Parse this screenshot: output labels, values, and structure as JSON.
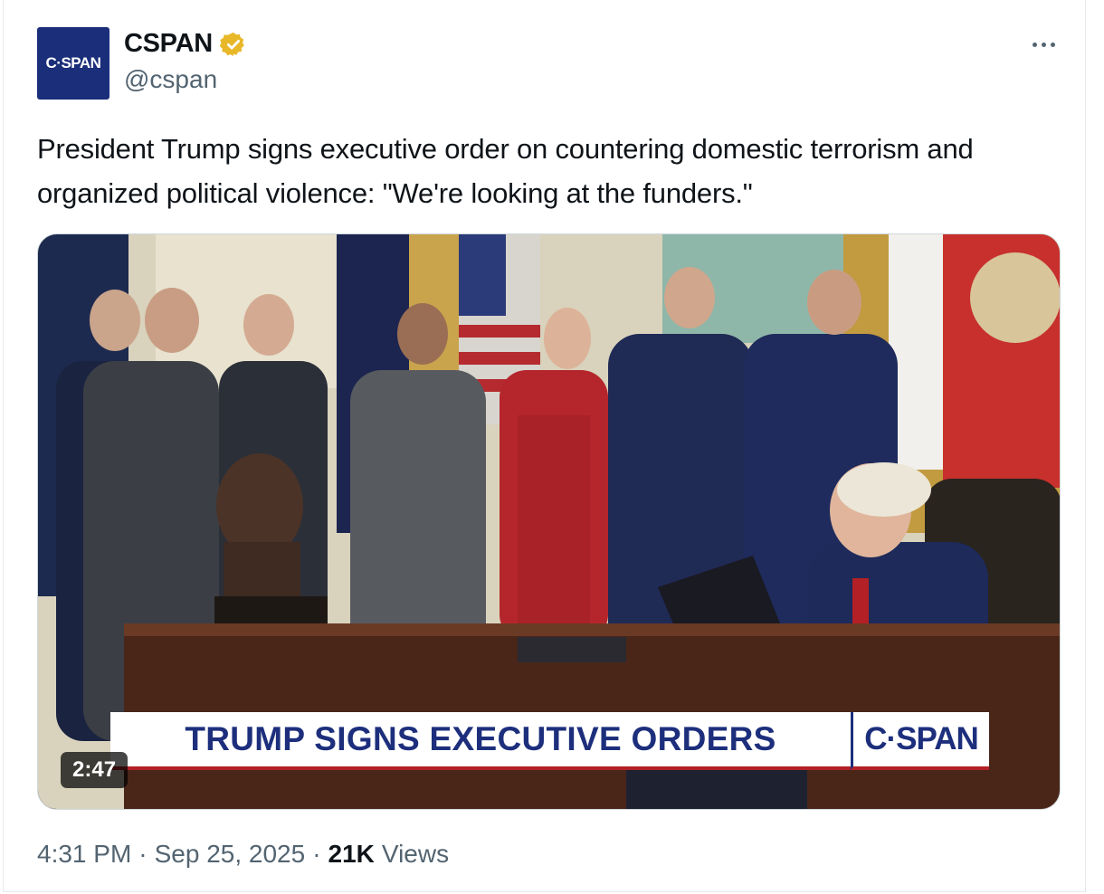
{
  "account": {
    "avatar_text": "C·SPAN",
    "display_name": "CSPAN",
    "handle": "@cspan",
    "verified": true
  },
  "tweet": {
    "text": "President Trump signs executive order on countering domestic terrorism and organized political violence: \"We're looking at the funders.\""
  },
  "media": {
    "lower_third": "TRUMP SIGNS EXECUTIVE ORDERS",
    "network_bug": "C·SPAN",
    "duration": "2:47"
  },
  "meta": {
    "time": "4:31 PM",
    "date": "Sep 25, 2025",
    "views_count": "21K",
    "views_label": "Views",
    "separator": "·"
  },
  "colors": {
    "cspan_blue": "#1d2f7c",
    "verified_gold": "#e8b829",
    "muted_text": "#536471"
  }
}
